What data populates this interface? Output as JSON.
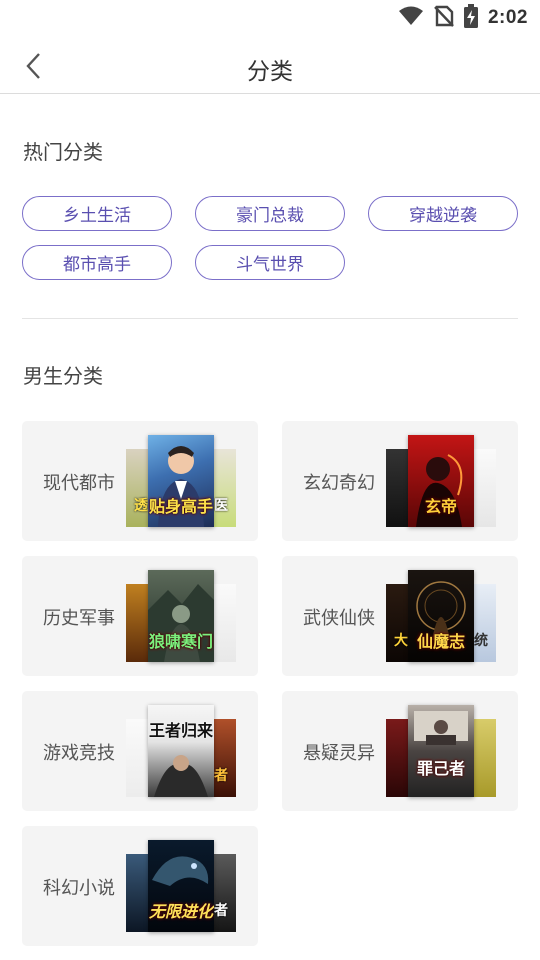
{
  "status": {
    "time": "2:02"
  },
  "header": {
    "title": "分类"
  },
  "hot": {
    "title": "热门分类",
    "tags": [
      "乡土生活",
      "豪门总裁",
      "穿越逆袭",
      "都市高手",
      "斗气世界"
    ]
  },
  "male": {
    "title": "男生分类",
    "categories": [
      {
        "label": "现代都市",
        "cover_title": "贴身高手",
        "side_left": "透",
        "side_right": "医"
      },
      {
        "label": "玄幻奇幻",
        "cover_title": "玄帝",
        "side_left": "",
        "side_right": ""
      },
      {
        "label": "历史军事",
        "cover_title": "狼啸寒门",
        "side_left": "",
        "side_right": ""
      },
      {
        "label": "武侠仙侠",
        "cover_title": "仙魔志",
        "side_left": "大",
        "side_right": "统"
      },
      {
        "label": "游戏竞技",
        "cover_title": "王者归来",
        "side_left": "",
        "side_right": "者"
      },
      {
        "label": "悬疑灵异",
        "cover_title": "罪己者",
        "side_left": "",
        "side_right": ""
      },
      {
        "label": "科幻小说",
        "cover_title": "无限进化",
        "side_left": "",
        "side_right": "者"
      }
    ]
  },
  "colors": {
    "accent": "#7b6fc9",
    "card_bg": "#f4f4f4"
  }
}
